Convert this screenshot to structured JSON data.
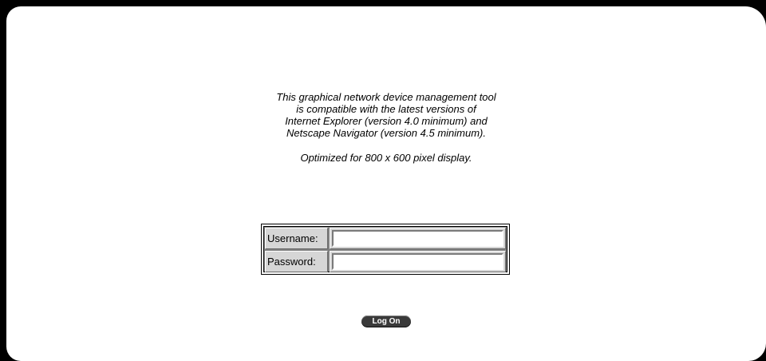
{
  "notice": {
    "lines": [
      "This graphical network device management tool",
      "is compatible with the latest versions of",
      "Internet Explorer (version 4.0 minimum) and",
      "Netscape Navigator (version 4.5 minimum)."
    ],
    "display_note": "Optimized for 800 x 600 pixel display."
  },
  "login": {
    "username_label": "Username:",
    "username_value": "",
    "password_label": "Password:",
    "password_value": ""
  },
  "logon_button": {
    "label": "Log On"
  },
  "colors": {
    "background": "#000000",
    "panel": "#ffffff",
    "button": "#3a3a3a"
  }
}
